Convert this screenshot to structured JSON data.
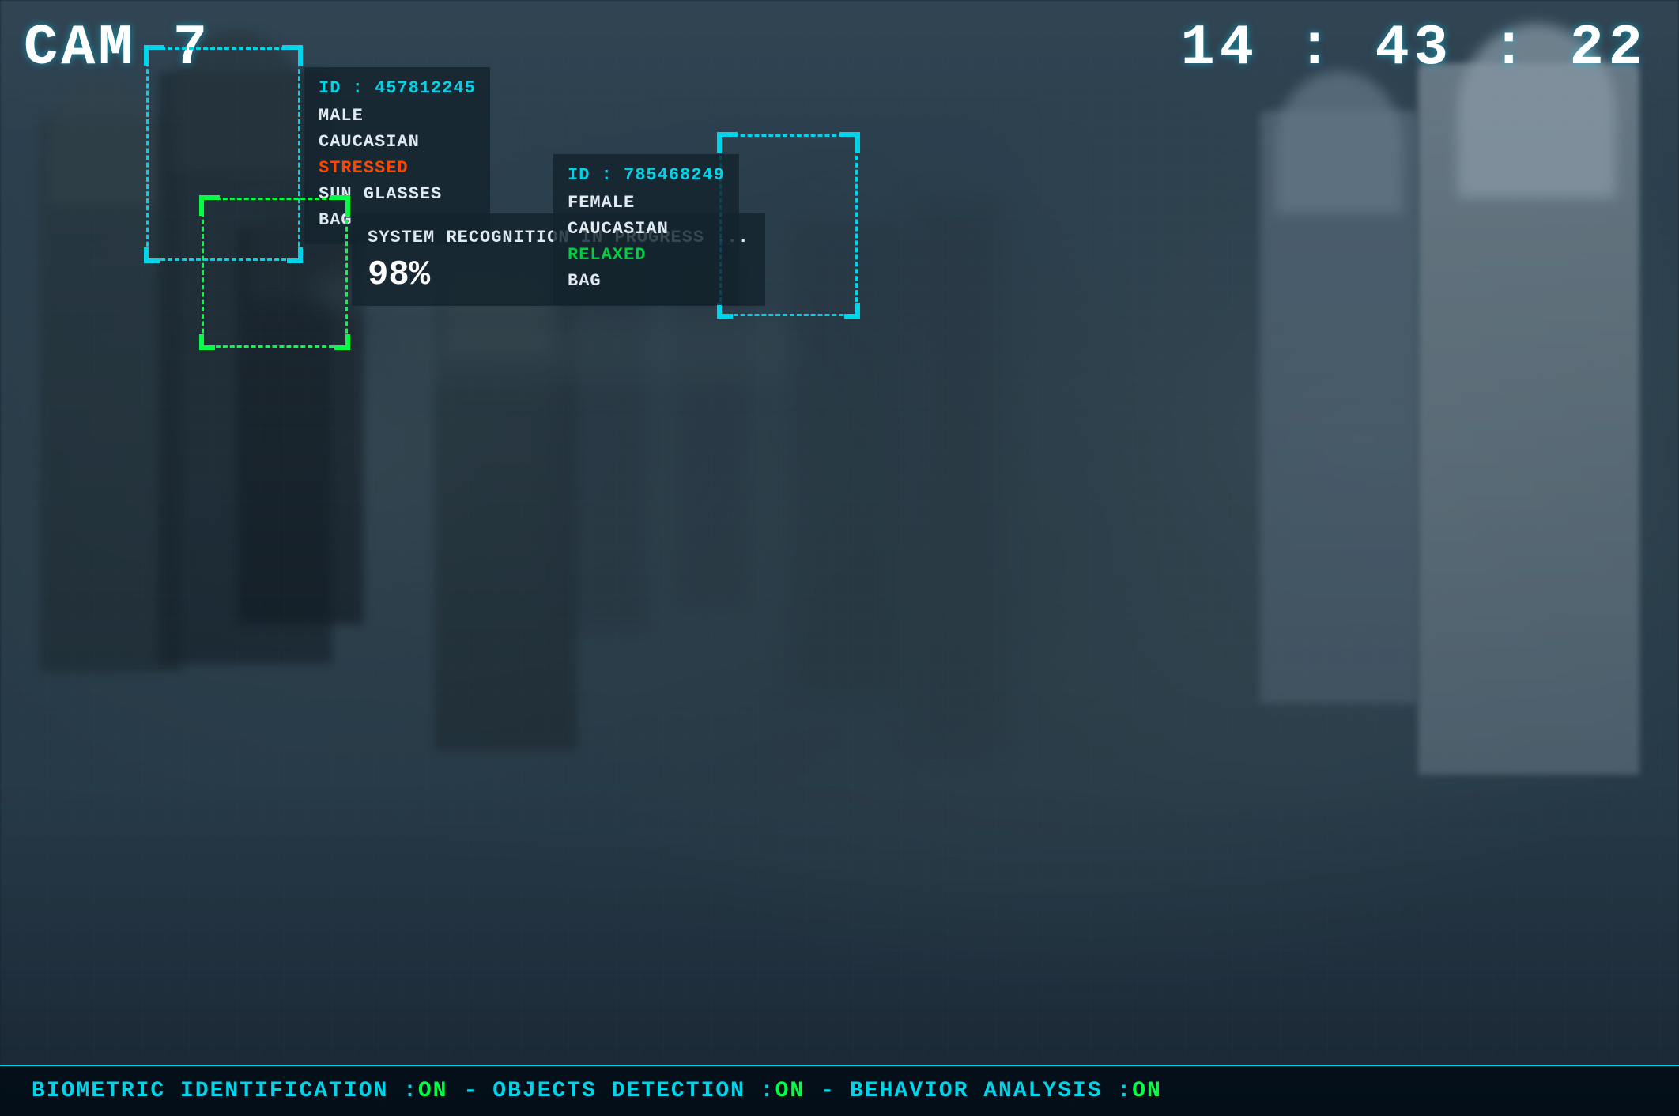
{
  "camera": {
    "label": "CAM 7",
    "timestamp": "14 : 43 : 22"
  },
  "detections": [
    {
      "id": "ID : 457812245",
      "gender": "MALE",
      "ethnicity": "CAUCASIAN",
      "emotion": "STRESSED",
      "accessory1": "SUN GLASSES",
      "accessory2": "BAG",
      "emotion_class": "stressed"
    },
    {
      "id": "ID : 785468249",
      "gender": "FEMALE",
      "ethnicity": "CAUCASIAN",
      "emotion": "RELAXED",
      "accessory1": "BAG",
      "emotion_class": "relaxed"
    }
  ],
  "recognition": {
    "label": "SYSTEM RECOGNITION IN PROGRESS ...",
    "percent": "98%"
  },
  "status_bar": {
    "biometric_label": "BIOMETRIC IDENTIFICATION : ",
    "biometric_value": "ON",
    "objects_label": "OBJECTS DETECTION : ",
    "objects_value": "ON",
    "behavior_label": "BEHAVIOR ANALYSIS : ",
    "behavior_value": "ON",
    "separator": " - "
  }
}
